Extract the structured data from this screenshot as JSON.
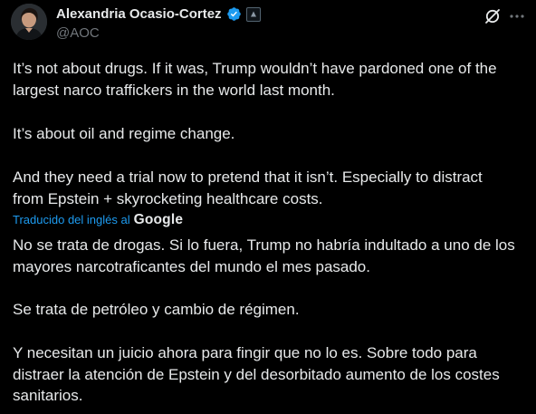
{
  "author": {
    "name": "Alexandria Ocasio-Cortez",
    "handle": "@AOC",
    "verified_color": "#1d9bf0"
  },
  "actions": {
    "grok_icon": "grok-icon",
    "more_icon": "more-options-icon"
  },
  "original": {
    "p1_l1": "It’s not about drugs. If it was, Trump wouldn’t have pardoned one of the",
    "p1_l2": "largest narco traffickers in the world last month.",
    "p2_l1": "It’s about oil and regime change.",
    "p3_l1": "And they need a trial now to pretend that it isn’t. Especially to distract",
    "p3_l2": "from Epstein + skyrocketing healthcare costs."
  },
  "translation_notice": {
    "label": "Traducido del inglés al",
    "provider": "Google"
  },
  "translated": {
    "p1_l1": "No se trata de drogas. Si lo fuera, Trump no habría indultado a uno de los",
    "p1_l2": "mayores narcotraficantes del mundo el mes pasado.",
    "p2_l1": "Se trata de petróleo y cambio de régimen.",
    "p3_l1": "Y necesitan un juicio ahora para fingir que no lo es. Sobre todo para",
    "p3_l2": "distraer la atención de Epstein y del desorbitado aumento de los costes",
    "p3_l3": "sanitarios."
  }
}
